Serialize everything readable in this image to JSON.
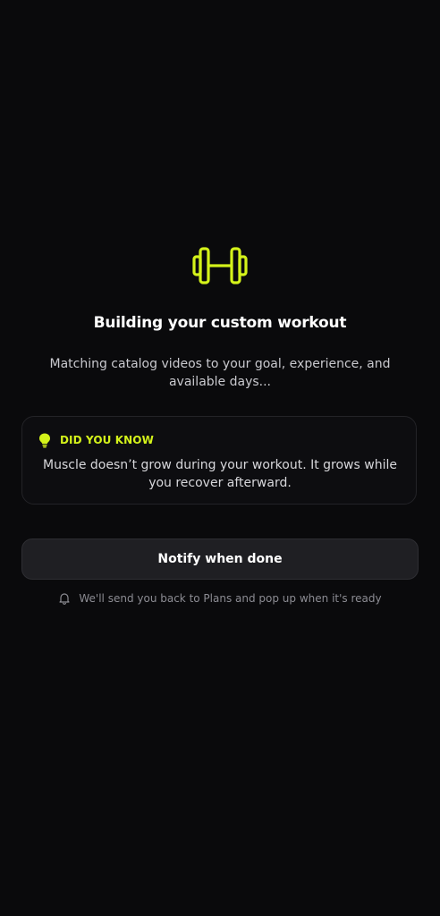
{
  "accent_color": "#d4f21a",
  "background_color": "#0a0a0c",
  "hero": {
    "icon": "dumbbell-icon",
    "title": "Building your custom workout",
    "subtitle": "Matching catalog videos to your goal, experience, and available days..."
  },
  "tip": {
    "icon": "lightbulb-icon",
    "heading": "DID YOU KNOW",
    "body": "Muscle doesn’t grow during your workout. It grows while you recover afterward."
  },
  "notify": {
    "button_label": "Notify when done",
    "hint_icon": "bell-icon",
    "hint": "We'll send you back to Plans and pop up when it's ready"
  }
}
